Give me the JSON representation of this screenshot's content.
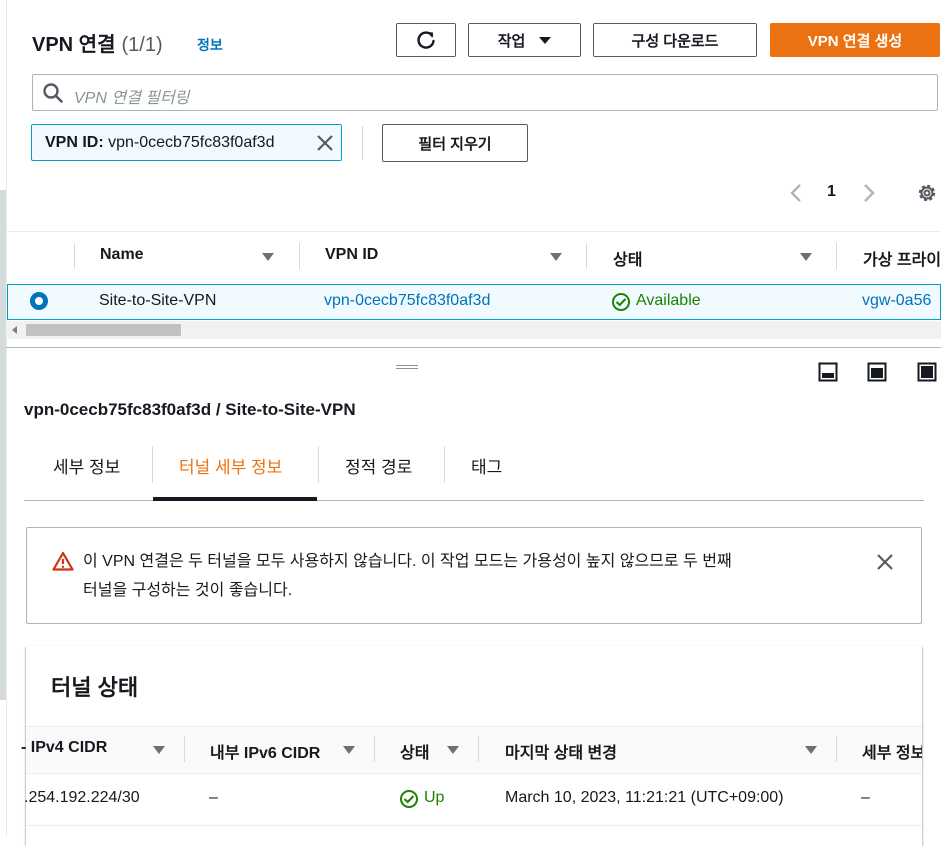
{
  "header": {
    "title": "VPN 연결",
    "count": "(1/1)",
    "info_link": "정보",
    "refresh_icon": "refresh-icon",
    "actions_label": "작업",
    "download_label": "구성 다운로드",
    "create_label": "VPN 연결 생성"
  },
  "filter": {
    "placeholder": "VPN 연결 필터링",
    "token_key": "VPN ID:",
    "token_value": "vpn-0cecb75fc83f0af3d",
    "clear_label": "필터 지우기"
  },
  "pagination": {
    "current_page": "1"
  },
  "table": {
    "columns": [
      "Name",
      "VPN ID",
      "상태",
      "가상 프라이"
    ],
    "rows": [
      {
        "name": "Site-to-Site-VPN",
        "vpn_id": "vpn-0cecb75fc83f0af3d",
        "status": "Available",
        "vgw": "vgw-0a56"
      }
    ]
  },
  "detail": {
    "title": "vpn-0cecb75fc83f0af3d / Site-to-Site-VPN",
    "tabs": [
      "세부 정보",
      "터널 세부 정보",
      "정적 경로",
      "태그"
    ],
    "active_tab": "터널 세부 정보",
    "alert_line1": "이 VPN 연결은 두 터널을 모두 사용하지 않습니다. 이 작업 모드는 가용성이 높지 않으므로 두 번째",
    "alert_line2": "터널을 구성하는 것이 좋습니다.",
    "alert_color": "#d13212",
    "tunnel_section_title": "터널 상태",
    "tunnel_columns": [
      "- IPv4 CIDR",
      "내부 IPv6 CIDR",
      "상태",
      "마지막 상태 변경",
      "세부 정보"
    ],
    "tunnel_rows": [
      {
        "ipv4": ".254.192.224/30",
        "ipv6": "–",
        "status": "Up",
        "last_change": "March 10, 2023, 11:21:21 (UTC+09:00)",
        "details": "–"
      }
    ]
  },
  "colors": {
    "accent": "#ec7211",
    "link": "#0073bb",
    "success": "#1d8102"
  }
}
